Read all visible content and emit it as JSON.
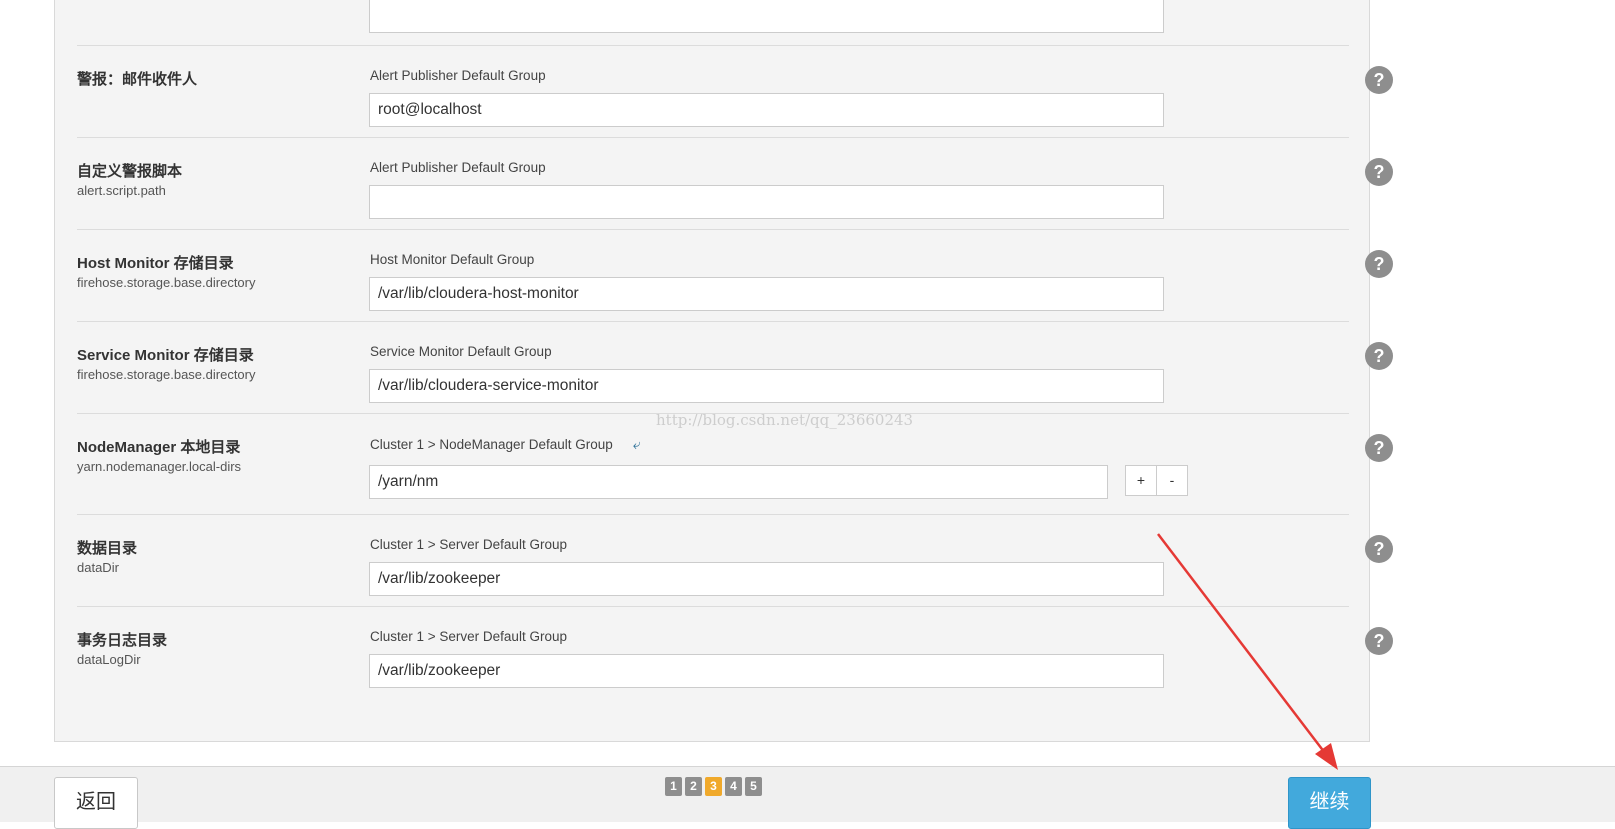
{
  "rows": [
    {
      "title": "",
      "key": "",
      "group": "",
      "value": ""
    },
    {
      "title": "警报：邮件收件人",
      "key": "",
      "group": "Alert Publisher Default Group",
      "value": "root@localhost"
    },
    {
      "title": "自定义警报脚本",
      "key": "alert.script.path",
      "group": "Alert Publisher Default Group",
      "value": ""
    },
    {
      "title": "Host Monitor 存储目录",
      "key": "firehose.storage.base.directory",
      "group": "Host Monitor Default Group",
      "value": "/var/lib/cloudera-host-monitor"
    },
    {
      "title": "Service Monitor 存储目录",
      "key": "firehose.storage.base.directory",
      "group": "Service Monitor Default Group",
      "value": "/var/lib/cloudera-service-monitor"
    },
    {
      "title": "NodeManager 本地目录",
      "key": "yarn.nodemanager.local-dirs",
      "group": "Cluster 1 > NodeManager Default Group",
      "value": "/yarn/nm",
      "add_label": "+",
      "remove_label": "-"
    },
    {
      "title": "数据目录",
      "key": "dataDir",
      "group": "Cluster 1 > Server Default Group",
      "value": "/var/lib/zookeeper"
    },
    {
      "title": "事务日志目录",
      "key": "dataLogDir",
      "group": "Cluster 1 > Server Default Group",
      "value": "/var/lib/zookeeper"
    }
  ],
  "help_label": "?",
  "watermark": "http://blog.csdn.net/qq_23660243",
  "footer": {
    "back_label": "返回",
    "next_label": "继续",
    "pages": [
      "1",
      "2",
      "3",
      "4",
      "5"
    ],
    "current_page": "3"
  },
  "colors": {
    "accent": "#42a9dc",
    "active_page": "#f0a92b",
    "annotation_arrow": "#e53935"
  }
}
